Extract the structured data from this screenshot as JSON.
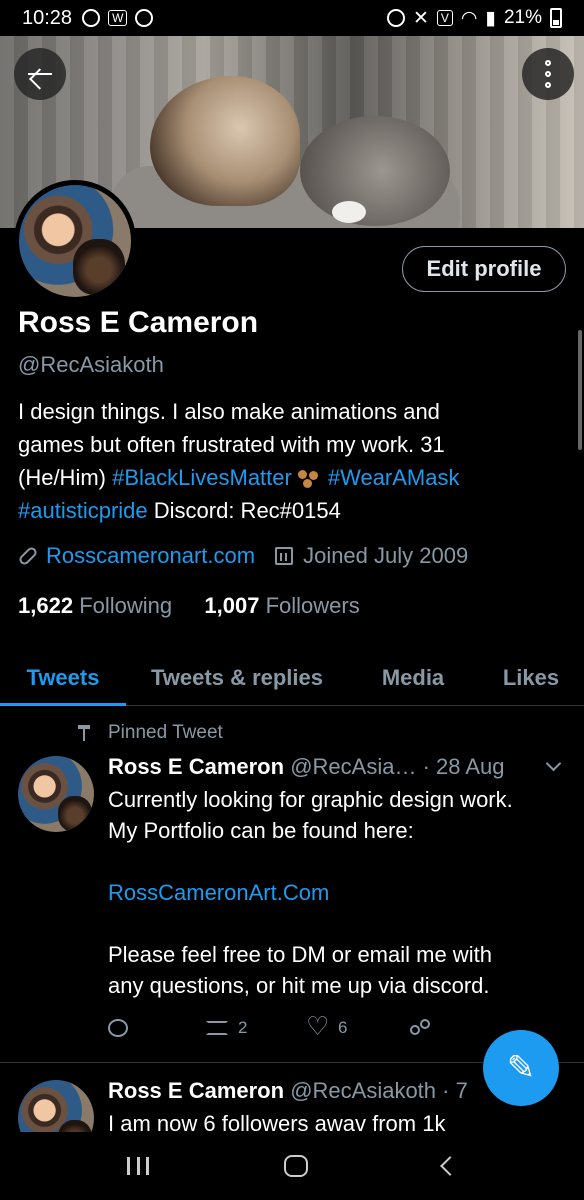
{
  "status_bar": {
    "time": "10:28",
    "battery": "21%"
  },
  "profile": {
    "edit_label": "Edit profile",
    "name": "Ross E Cameron",
    "handle": "@RecAsiakoth",
    "bio_line1": "I design things. I also make animations and",
    "bio_line2": "games but often frustrated with my work.  31",
    "bio_line3_a": "(He/Him) ",
    "bio_tag1": "#BlackLivesMatter",
    "bio_tag2": "#WearAMask",
    "bio_tag3": "#autisticpride",
    "bio_line4_b": " Discord: Rec#0154",
    "website": "Rosscameronart.com",
    "joined": "Joined July 2009",
    "following_count": "1,622",
    "following_label": "Following",
    "followers_count": "1,007",
    "followers_label": "Followers"
  },
  "tabs": [
    {
      "label": "Tweets",
      "active": true
    },
    {
      "label": "Tweets & replies",
      "active": false
    },
    {
      "label": "Media",
      "active": false
    },
    {
      "label": "Likes",
      "active": false
    }
  ],
  "pinned_label": "Pinned Tweet",
  "tweets": [
    {
      "name": "Ross E Cameron",
      "handle": "@RecAsia…",
      "time": "· 28 Aug",
      "line1": "Currently looking for graphic design work.",
      "line2": "My Portfolio can be found here:",
      "link": "RossCameronArt.Com",
      "line3": "Please feel free to DM or email me with",
      "line4": "any questions, or hit me up via discord.",
      "retweets": "2",
      "likes": "6"
    },
    {
      "name": "Ross E Cameron",
      "handle": "@RecAsiakoth",
      "time": "· 7",
      "line1": "I am now 6 followers awav from 1k"
    }
  ],
  "icons": {
    "back": "back-arrow-icon",
    "more": "more-options-icon",
    "compose": "compose-tweet-icon"
  },
  "colors": {
    "accent": "#1d9bf0",
    "muted": "#8899a6",
    "background": "#000000"
  }
}
